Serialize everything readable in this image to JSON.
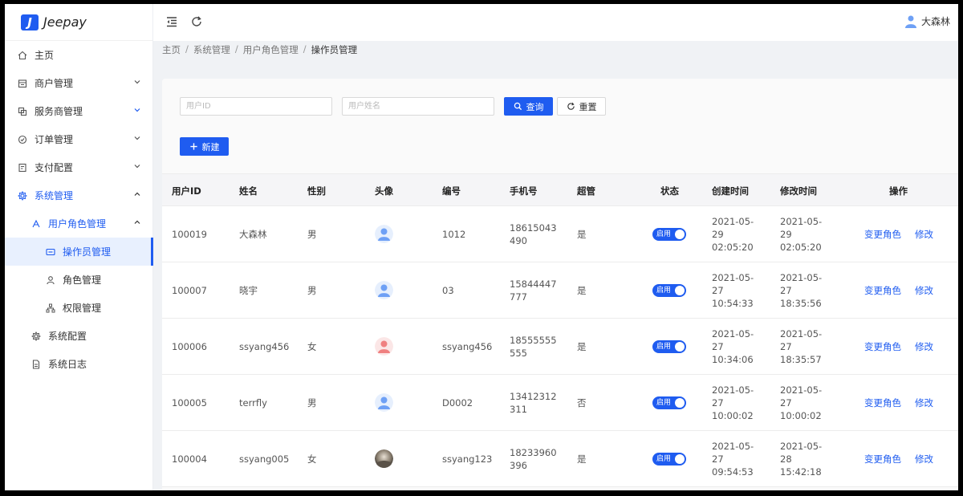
{
  "app": {
    "name": "Jeepay",
    "logo_letter": "J"
  },
  "header": {
    "username": "大森林"
  },
  "sidebar": {
    "items": [
      {
        "label": "主页",
        "icon": "home-icon"
      },
      {
        "label": "商户管理",
        "icon": "shop-icon"
      },
      {
        "label": "服务商管理",
        "icon": "partner-icon"
      },
      {
        "label": "订单管理",
        "icon": "order-icon"
      },
      {
        "label": "支付配置",
        "icon": "payment-config-icon"
      },
      {
        "label": "系统管理",
        "icon": "settings-icon"
      },
      {
        "label": "用户角色管理",
        "icon": "user-role-icon"
      },
      {
        "label": "操作员管理",
        "icon": "operator-icon"
      },
      {
        "label": "角色管理",
        "icon": "role-icon"
      },
      {
        "label": "权限管理",
        "icon": "permission-icon"
      },
      {
        "label": "系统配置",
        "icon": "gear-icon"
      },
      {
        "label": "系统日志",
        "icon": "log-icon"
      }
    ]
  },
  "breadcrumb": [
    "主页",
    "系统管理",
    "用户角色管理",
    "操作员管理"
  ],
  "search": {
    "user_id_placeholder": "用户ID",
    "user_name_placeholder": "用户姓名",
    "query_label": "查询",
    "reset_label": "重置",
    "new_label": "新建"
  },
  "table": {
    "columns": [
      "用户ID",
      "姓名",
      "性别",
      "头像",
      "编号",
      "手机号",
      "超管",
      "状态",
      "创建时间",
      "修改时间",
      "操作"
    ],
    "status_label": "启用",
    "action_change_role": "变更角色",
    "action_edit": "修改",
    "rows": [
      {
        "id": "100019",
        "name": "大森林",
        "gender": "男",
        "avatar": "male",
        "code": "1012",
        "phone": "18615043490",
        "admin": "是",
        "created_date": "2021-05-29",
        "created_time": "02:05:20",
        "updated_date": "2021-05-29",
        "updated_time": "02:05:20"
      },
      {
        "id": "100007",
        "name": "晓宇",
        "gender": "男",
        "avatar": "male",
        "code": "03",
        "phone": "15844447777",
        "admin": "是",
        "created_date": "2021-05-27",
        "created_time": "10:54:33",
        "updated_date": "2021-05-27",
        "updated_time": "18:35:56"
      },
      {
        "id": "100006",
        "name": "ssyang456",
        "gender": "女",
        "avatar": "female",
        "code": "ssyang456",
        "phone": "18555555555",
        "admin": "是",
        "created_date": "2021-05-27",
        "created_time": "10:34:06",
        "updated_date": "2021-05-27",
        "updated_time": "18:35:57"
      },
      {
        "id": "100005",
        "name": "terrfly",
        "gender": "男",
        "avatar": "male",
        "code": "D0002",
        "phone": "13412312311",
        "admin": "否",
        "created_date": "2021-05-27",
        "created_time": "10:00:02",
        "updated_date": "2021-05-27",
        "updated_time": "10:00:02"
      },
      {
        "id": "100004",
        "name": "ssyang005",
        "gender": "女",
        "avatar": "photo",
        "code": "ssyang123",
        "phone": "18233960396",
        "admin": "是",
        "created_date": "2021-05-27",
        "created_time": "09:54:53",
        "updated_date": "2021-05-28",
        "updated_time": "15:42:18"
      }
    ]
  },
  "colors": {
    "primary": "#1f5cf0",
    "male_avatar": "#6ea0f5",
    "female_avatar": "#ef8080"
  }
}
